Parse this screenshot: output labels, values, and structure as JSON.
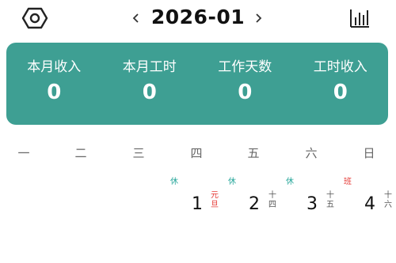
{
  "header": {
    "month": "2026-01",
    "prev_glyph": "‹",
    "next_glyph": "›",
    "settings_icon": "hexagon-settings-icon",
    "stats_icon": "bar-chart-icon"
  },
  "summary": {
    "items": [
      {
        "label": "本月收入",
        "value": "0"
      },
      {
        "label": "本月工时",
        "value": "0"
      },
      {
        "label": "工作天数",
        "value": "0"
      },
      {
        "label": "工时收入",
        "value": "0"
      }
    ]
  },
  "weekdays": [
    "一",
    "二",
    "三",
    "四",
    "五",
    "六",
    "日"
  ],
  "days": [
    {
      "day": "1",
      "mark": "休",
      "lunar_top": "元",
      "lunar_bottom": "旦",
      "mark_type": "rest",
      "lunar_holiday": true
    },
    {
      "day": "2",
      "mark": "休",
      "lunar_top": "十",
      "lunar_bottom": "四",
      "mark_type": "rest",
      "lunar_holiday": false
    },
    {
      "day": "3",
      "mark": "休",
      "lunar_top": "十",
      "lunar_bottom": "五",
      "mark_type": "rest",
      "lunar_holiday": false
    },
    {
      "day": "4",
      "mark": "班",
      "lunar_top": "十",
      "lunar_bottom": "六",
      "mark_type": "work",
      "lunar_holiday": false
    }
  ],
  "colors": {
    "accent": "#3e9f93",
    "rest_mark": "#26a69a",
    "work_mark": "#e53935"
  }
}
